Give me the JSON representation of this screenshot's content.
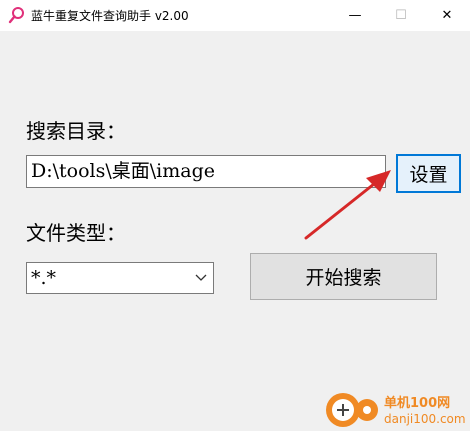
{
  "window": {
    "title": "蓝牛重复文件查询助手 v2.00",
    "minimize_glyph": "—",
    "maximize_glyph": "☐",
    "close_glyph": "✕"
  },
  "form": {
    "search_dir_label": "搜索目录：",
    "search_dir_value": "D:\\tools\\桌面\\image",
    "settings_button": "设置",
    "file_type_label": "文件类型：",
    "file_type_value": "*.*",
    "start_search_button": "开始搜索"
  },
  "colors": {
    "annotation_arrow": "#d62828",
    "focus_border": "#0078d7",
    "watermark_orange": "#f08a24"
  },
  "watermark": {
    "site_name": "单机100网",
    "url": "danji100.com"
  }
}
